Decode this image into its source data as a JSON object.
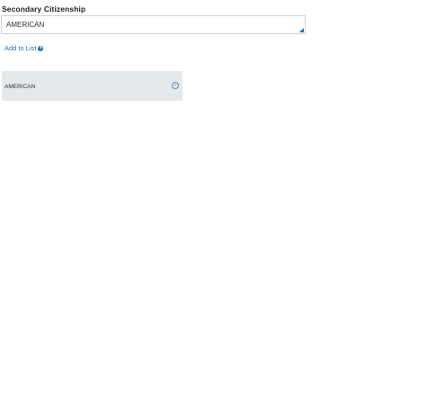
{
  "secondary_citizenship": {
    "label": "Secondary Citizenship",
    "input_value": "AMERICAN",
    "add_link_label": "Add to List",
    "add_icon_glyph": "+",
    "add_icon_name": "plus-circle-icon",
    "resize_icon_name": "resize-corner-icon",
    "list_items": [
      {
        "label": "AMERICAN",
        "remove_icon_glyph": "×",
        "remove_icon_name": "remove-circle-icon"
      }
    ]
  },
  "colors": {
    "accent": "#2a6db5",
    "list_item_bg": "#e4e9ec",
    "border": "#cfd3d6"
  }
}
